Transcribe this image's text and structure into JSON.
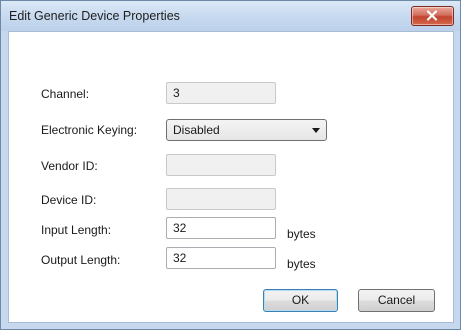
{
  "window": {
    "title": "Edit Generic Device Properties"
  },
  "form": {
    "channel": {
      "label": "Channel:",
      "value": "3"
    },
    "keying": {
      "label": "Electronic Keying:",
      "value": "Disabled"
    },
    "vendor_id": {
      "label": "Vendor ID:",
      "value": ""
    },
    "device_id": {
      "label": "Device ID:",
      "value": ""
    },
    "input_length": {
      "label": "Input Length:",
      "value": "32",
      "unit": "bytes"
    },
    "output_length": {
      "label": "Output Length:",
      "value": "32",
      "unit": "bytes"
    }
  },
  "buttons": {
    "ok": "OK",
    "cancel": "Cancel"
  },
  "icons": {
    "close": "close-icon",
    "dropdown": "chevron-down-icon"
  },
  "colors": {
    "titlebar": "#c6d9ef",
    "close_button": "#c2432f",
    "default_button_border": "#3c7fb1"
  }
}
